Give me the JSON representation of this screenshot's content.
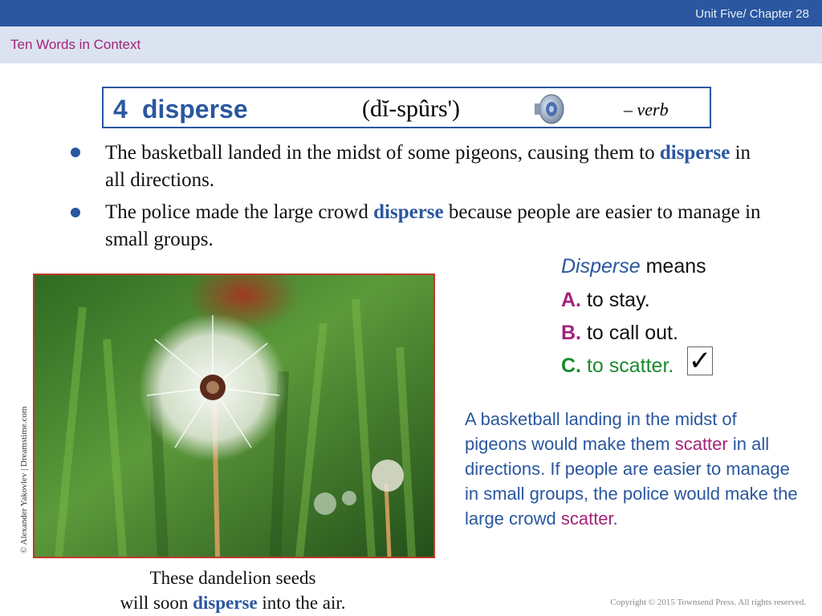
{
  "header": {
    "unit_chapter": "Unit Five/ Chapter 28",
    "section_title": "Ten Words in Context"
  },
  "entry": {
    "number": "4",
    "word": "disperse",
    "pronunciation": "(dĭ-spûrs')",
    "part_of_speech": "– verb",
    "speaker_icon": "speaker-icon"
  },
  "sentences": [
    {
      "pre": "The basketball landed in the midst of some pigeons, causing them to ",
      "word": "disperse",
      "post": " in all directions."
    },
    {
      "pre": "The police made the large crowd ",
      "word": "disperse",
      "post": " because people are easier to manage in small groups."
    }
  ],
  "question": {
    "word": "Disperse",
    "stem": " means",
    "options": [
      {
        "letter": "A.",
        "text": " to stay."
      },
      {
        "letter": "B.",
        "text": " to call out."
      },
      {
        "letter": "C.",
        "text": " to scatter."
      }
    ],
    "check": "✓"
  },
  "explanation": {
    "part1": "A basketball landing in the midst of pigeons would make them ",
    "scatter1": "scatter",
    "part2": " in all directions. If people are easier to manage in small groups, the police would make the large crowd ",
    "scatter2": "scatter",
    "part3": "."
  },
  "image": {
    "credit": "© Alexander Yakovlev | Dreamstime.com",
    "caption_line1": "These dandelion seeds",
    "caption_pre": "will soon ",
    "caption_word": "disperse",
    "caption_post": " into the air."
  },
  "footer": {
    "copyright": "Copyright © 2015 Townsend Press. All rights reserved."
  },
  "colors": {
    "brand_blue": "#2a579f",
    "accent_magenta": "#a3237a",
    "correct_green": "#1c8a2e"
  }
}
